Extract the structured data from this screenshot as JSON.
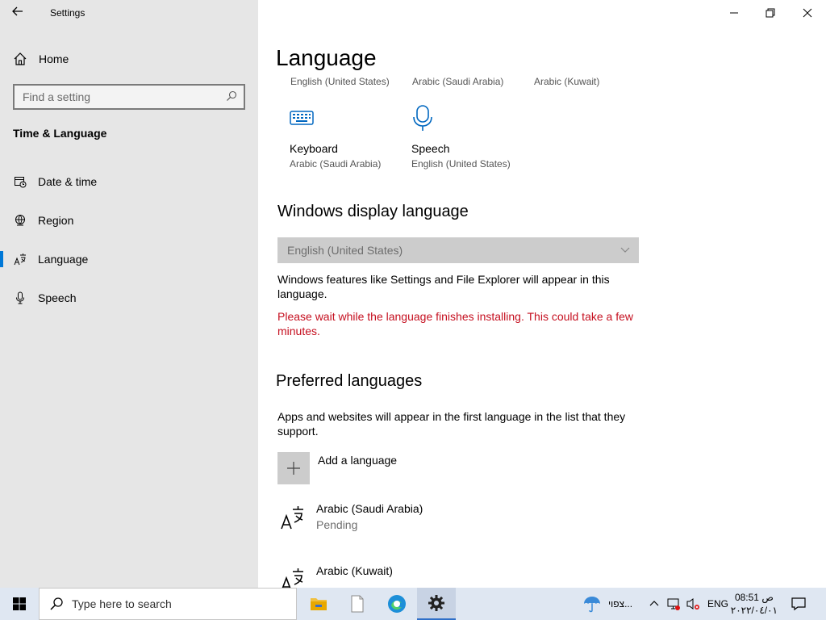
{
  "window": {
    "app_title": "Settings",
    "minimize_label": "Minimize",
    "restore_label": "Restore",
    "close_label": "Close"
  },
  "sidebar": {
    "home_label": "Home",
    "search_placeholder": "Find a setting",
    "section_title": "Time & Language",
    "items": [
      {
        "label": "Date & time",
        "icon": "date-time-icon"
      },
      {
        "label": "Region",
        "icon": "region-icon"
      },
      {
        "label": "Language",
        "icon": "language-icon",
        "active": true
      },
      {
        "label": "Speech",
        "icon": "microphone-icon"
      }
    ]
  },
  "main": {
    "title": "Language",
    "quick_links": [
      "English (United States)",
      "Arabic (Saudi Arabia)",
      "Arabic (Kuwait)"
    ],
    "tiles": [
      {
        "title": "Keyboard",
        "subtitle": "Arabic (Saudi Arabia)",
        "icon": "keyboard-icon"
      },
      {
        "title": "Speech",
        "subtitle": "English (United States)",
        "icon": "microphone-icon"
      }
    ],
    "display_language": {
      "heading": "Windows display language",
      "selected": "English (United States)",
      "description": "Windows features like Settings and File Explorer will appear in this language.",
      "warning": "Please wait while the language finishes installing. This could take a few minutes."
    },
    "preferred": {
      "heading": "Preferred languages",
      "description": "Apps and websites will appear in the first language in the list that they support.",
      "add_label": "Add a language",
      "languages": [
        {
          "name": "Arabic (Saudi Arabia)",
          "status": "Pending"
        },
        {
          "name": "Arabic (Kuwait)",
          "status": ""
        }
      ]
    }
  },
  "taskbar": {
    "search_placeholder": "Type here to search",
    "weather_text": "צפוי...",
    "lang_indicator": "ENG",
    "time": "08:51 ص",
    "date": "٢٠٢٢/٠٤/٠١"
  },
  "colors": {
    "accent": "#0078d7",
    "warning": "#c50f1f",
    "sidebar_bg": "#e6e6e6",
    "taskbar_bg": "#dfe7f2"
  }
}
